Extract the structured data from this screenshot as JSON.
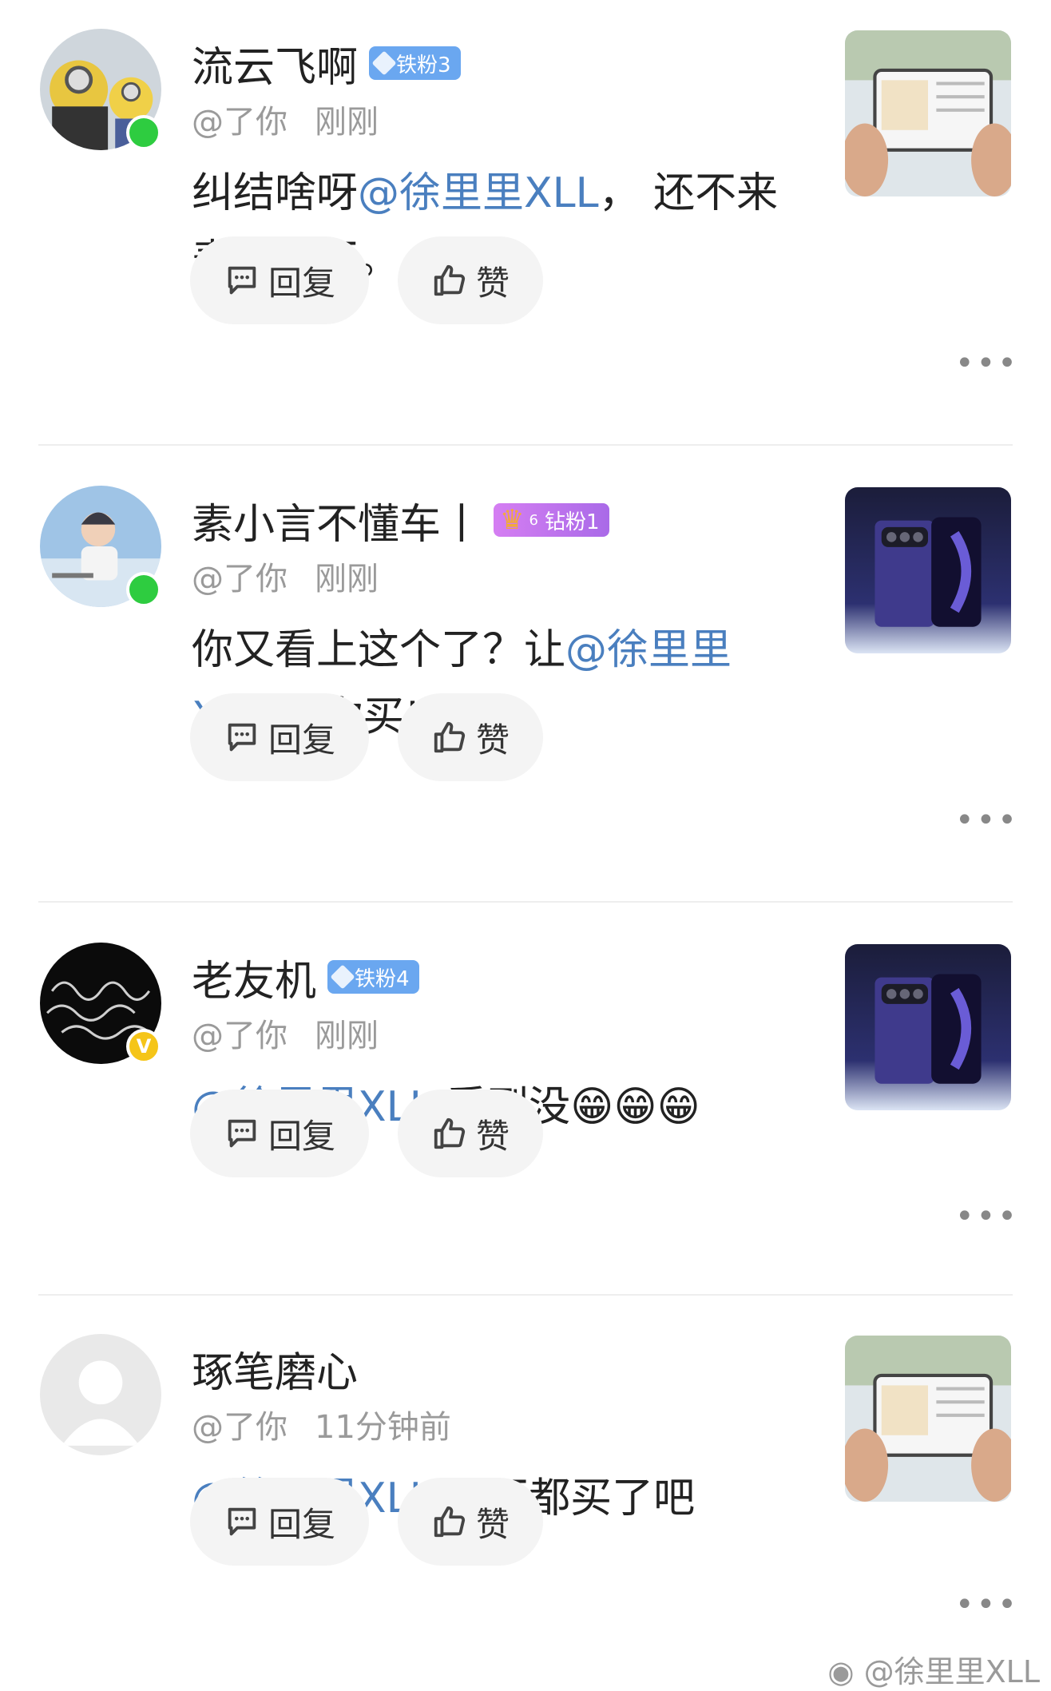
{
  "comments": [
    {
      "username": "流云飞啊",
      "badge": "铁粉3",
      "meta_user": "@了你",
      "meta_time": "刚刚",
      "text_prefix": "纠结啥呀",
      "mention": "@徐里里XLL",
      "text_suffix": "， 还不来表现一下。",
      "reply_label": "回复",
      "like_label": "赞"
    },
    {
      "username": "素小言不懂车丨",
      "badge": "钻粉1",
      "badge_level": "6",
      "meta_user": "@了你",
      "meta_time": "刚刚",
      "text_prefix": "你又看上这个了？让",
      "mention": "@徐里里XLL",
      "text_suffix": " 给你买!",
      "reply_label": "回复",
      "like_label": "赞"
    },
    {
      "username": "老友机",
      "badge": "铁粉4",
      "meta_user": "@了你",
      "meta_time": "刚刚",
      "text_prefix": "",
      "mention": "@徐里里XLL",
      "text_suffix": " 看到没😁😁😁",
      "reply_label": "回复",
      "like_label": "赞"
    },
    {
      "username": "琢笔磨心",
      "badge": "",
      "meta_user": "@了你",
      "meta_time": "11分钟前",
      "text_prefix": "",
      "mention": "@徐里里XLL",
      "text_suffix": " 要不都买了吧",
      "reply_label": "回复",
      "like_label": "赞"
    }
  ],
  "more_label": "•••",
  "watermark": "@徐里里XLL",
  "colors": {
    "mention": "#4a7fbf",
    "iron_badge": "#6aa7f0",
    "diamond_badge": "#b46ee9",
    "online": "#2ecc40",
    "vip": "#f5c518"
  }
}
